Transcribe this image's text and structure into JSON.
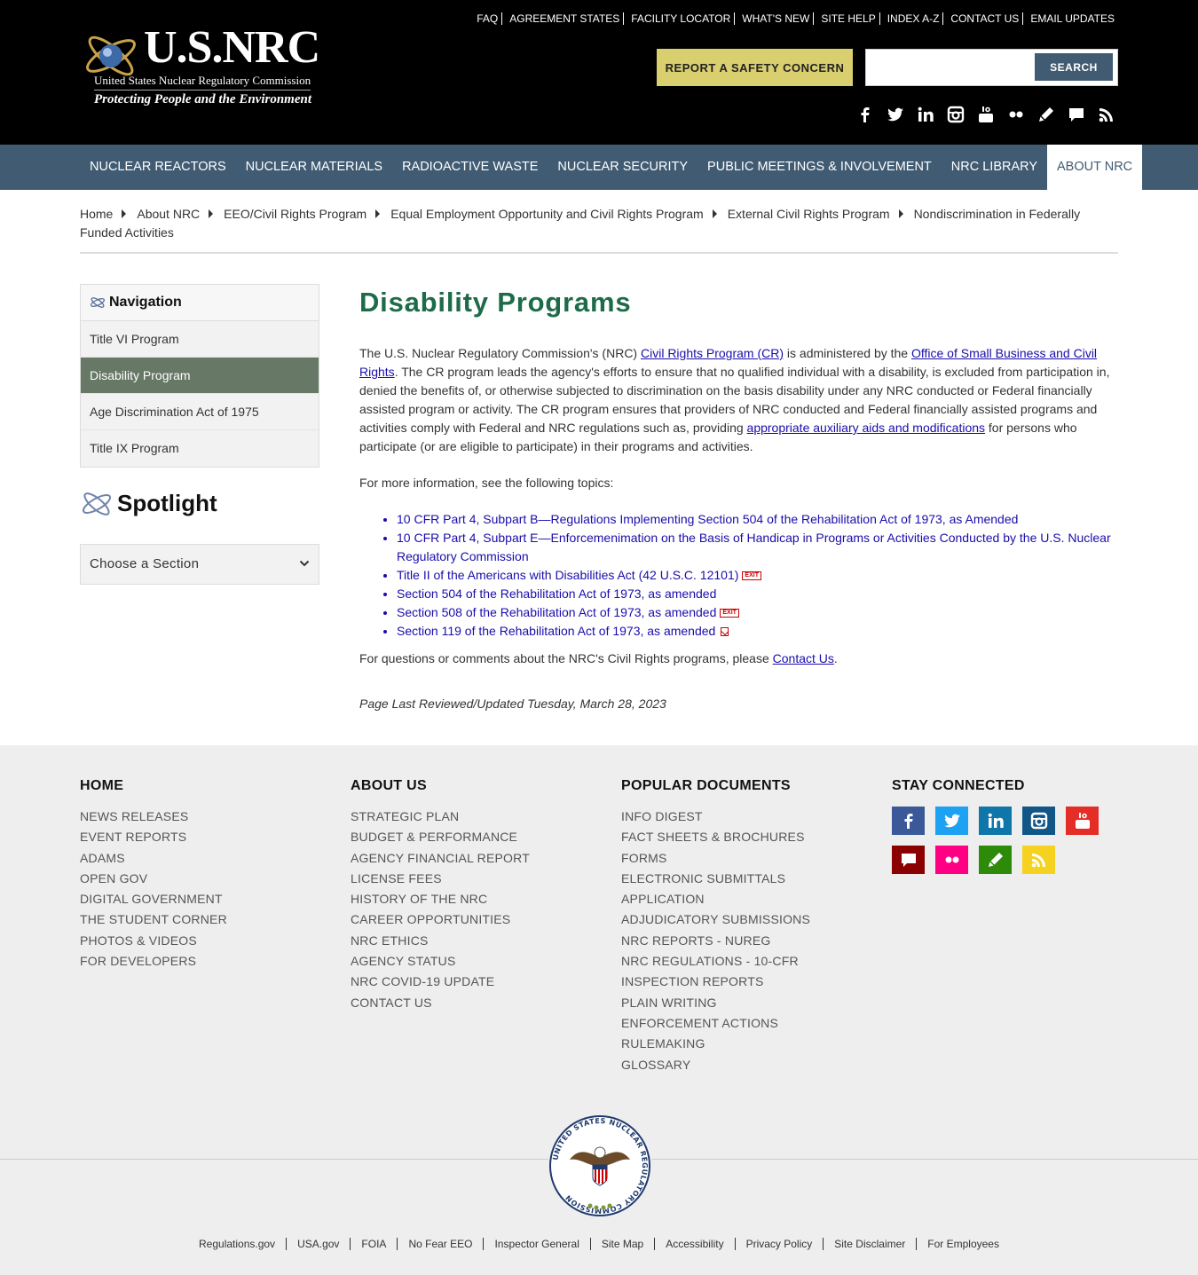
{
  "header": {
    "brand": "U.S.NRC",
    "org_name": "United States Nuclear Regulatory Commission",
    "tagline": "Protecting People and the Environment",
    "utility_links": [
      "FAQ",
      "AGREEMENT STATES",
      "FACILITY LOCATOR",
      "WHAT'S NEW",
      "SITE HELP",
      "INDEX A-Z",
      "CONTACT US",
      "EMAIL UPDATES"
    ],
    "report_button": "REPORT A SAFETY CONCERN",
    "search_placeholder": "",
    "search_button": "SEARCH",
    "social_icons": [
      "facebook-icon",
      "twitter-icon",
      "linkedin-icon",
      "instagram-icon",
      "youtube-icon",
      "flickr-icon",
      "blog-icon",
      "chat-icon",
      "rss-icon"
    ]
  },
  "mainnav": {
    "items": [
      "NUCLEAR REACTORS",
      "NUCLEAR MATERIALS",
      "RADIOACTIVE WASTE",
      "NUCLEAR SECURITY",
      "PUBLIC MEETINGS & INVOLVEMENT",
      "NRC LIBRARY",
      "ABOUT NRC"
    ],
    "active": "ABOUT NRC"
  },
  "breadcrumb": [
    "Home",
    "About NRC",
    "EEO/Civil Rights Program",
    "Equal Employment Opportunity and Civil Rights Program",
    "External Civil Rights Program",
    "Nondiscrimination in Federally Funded Activities"
  ],
  "sidebar": {
    "nav_title": "Navigation",
    "items": [
      "Title VI Program",
      "Disability Program",
      "Age Discrimination Act of 1975",
      "Title IX Program"
    ],
    "active": "Disability Program",
    "spotlight_title": "Spotlight",
    "section_select": "Choose a Section"
  },
  "content": {
    "title": "Disability Programs",
    "p1_a": "The U.S. Nuclear Regulatory Commission's (NRC) ",
    "p1_link1": "Civil Rights Program (CR)",
    "p1_b": " is administered by the ",
    "p1_link2": "Office of Small Business and Civil Rights",
    "p1_c": ".  The CR program leads the agency's efforts to ensure that no qualified individual with a disability, is excluded from participation in, denied the benefits of, or otherwise subjected to discrimination on the basis disability under any NRC conducted or Federal financially assisted program or activity. The CR program ensures that providers of NRC conducted and Federal financially assisted programs and activities comply with Federal and NRC regulations such as, providing ",
    "p1_link3": "appropriate auxiliary aids and modifications",
    "p1_d": " for persons who participate (or are eligible to participate) in their programs and activities.",
    "p2": "For more information, see the following topics:",
    "topics": [
      "10 CFR Part 4, Subpart B—Regulations Implementing Section 504 of the Rehabilitation Act of 1973, as Amended",
      "10 CFR Part 4, Subpart E—Enforcemenimation on the Basis of Handicap in Programs or Activities Conducted by the U.S. Nuclear Regulatory Commission",
      "Title II of the Americans with Disabilities Act (42 U.S.C. 12101)",
      "Section 504 of the Rehabilitation Act of 1973, as amended",
      "Section 508 of the Rehabilitation Act of 1973, as amended",
      "Section 119 of the Rehabilitation Act of 1973, as amended"
    ],
    "exit_label": "EXIT",
    "p3_a": "For questions or comments about the NRC's Civil Rights programs, please ",
    "p3_link": "Contact Us",
    "p3_b": ".",
    "reviewed": "Page Last Reviewed/Updated Tuesday, March 28, 2023"
  },
  "footer": {
    "col1": {
      "title": "HOME",
      "links": [
        "NEWS RELEASES",
        "EVENT REPORTS",
        "ADAMS",
        "OPEN GOV",
        "DIGITAL GOVERNMENT",
        "THE STUDENT CORNER",
        "PHOTOS & VIDEOS",
        "FOR DEVELOPERS"
      ]
    },
    "col2": {
      "title": "ABOUT US",
      "links": [
        "STRATEGIC PLAN",
        "BUDGET & PERFORMANCE",
        "AGENCY FINANCIAL REPORT",
        "LICENSE FEES",
        "HISTORY OF THE NRC",
        "CAREER OPPORTUNITIES",
        "NRC ETHICS",
        "AGENCY STATUS",
        "NRC COVID-19 UPDATE",
        "CONTACT US"
      ]
    },
    "col3": {
      "title": "POPULAR DOCUMENTS",
      "links": [
        "INFO DIGEST",
        "FACT SHEETS & BROCHURES",
        "FORMS",
        "ELECTRONIC SUBMITTALS",
        "APPLICATION",
        "ADJUDICATORY SUBMISSIONS",
        "NRC REPORTS - NUREG",
        "NRC REGULATIONS - 10-CFR",
        "INSPECTION REPORTS",
        "PLAIN WRITING",
        "ENFORCEMENT ACTIONS",
        "RULEMAKING",
        "GLOSSARY"
      ]
    },
    "col4": {
      "title": "STAY CONNECTED"
    },
    "social": [
      {
        "name": "facebook-icon",
        "color": "#3b5998"
      },
      {
        "name": "twitter-icon",
        "color": "#1da1f2"
      },
      {
        "name": "linkedin-icon",
        "color": "#0e76a8"
      },
      {
        "name": "instagram-icon",
        "color": "#125688"
      },
      {
        "name": "youtube-icon",
        "color": "#e52d27"
      },
      {
        "name": "chat-icon",
        "color": "#8b0000"
      },
      {
        "name": "flickr-icon",
        "color": "#ff0084"
      },
      {
        "name": "blog-icon",
        "color": "#2e8b0a"
      },
      {
        "name": "rss-icon",
        "color": "#f4d21f"
      }
    ],
    "seal_text": "UNITED STATES NUCLEAR REGULATORY COMMISSION",
    "bottom_links": [
      "Regulations.gov",
      "USA.gov",
      "FOIA",
      "No Fear EEO",
      "Inspector General",
      "Site Map",
      "Accessibility",
      "Privacy Policy",
      "Site Disclaimer",
      "For Employees"
    ]
  }
}
